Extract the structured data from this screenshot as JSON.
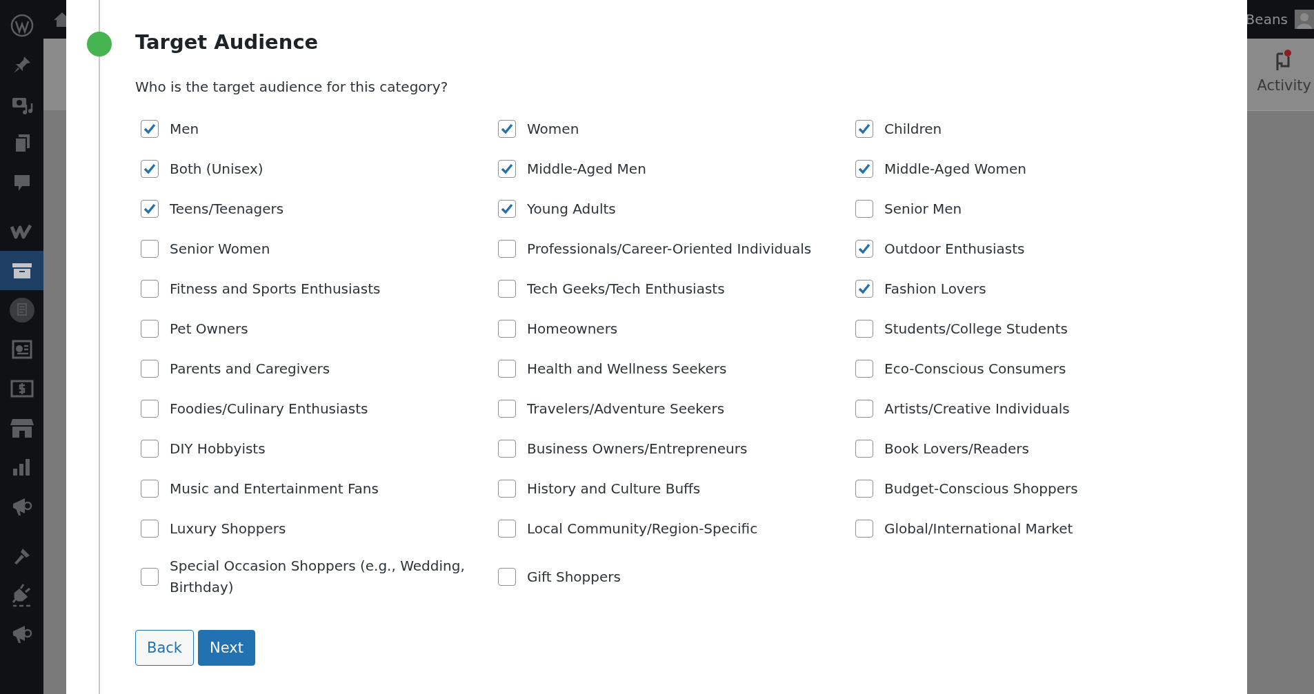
{
  "admin_bar": {
    "user_name": "Beans"
  },
  "activity_panel": {
    "label": "Activity"
  },
  "step": {
    "title": "Target Audience",
    "question": "Who is the target audience for this category?"
  },
  "options": [
    {
      "label": "Men",
      "checked": true
    },
    {
      "label": "Women",
      "checked": true
    },
    {
      "label": "Children",
      "checked": true
    },
    {
      "label": "Both (Unisex)",
      "checked": true
    },
    {
      "label": "Middle-Aged Men",
      "checked": true
    },
    {
      "label": "Middle-Aged Women",
      "checked": true
    },
    {
      "label": "Teens/Teenagers",
      "checked": true
    },
    {
      "label": "Young Adults",
      "checked": true
    },
    {
      "label": "Senior Men",
      "checked": false
    },
    {
      "label": "Senior Women",
      "checked": false
    },
    {
      "label": "Professionals/Career-Oriented Individuals",
      "checked": false
    },
    {
      "label": "Outdoor Enthusiasts",
      "checked": true
    },
    {
      "label": "Fitness and Sports Enthusiasts",
      "checked": false
    },
    {
      "label": "Tech Geeks/Tech Enthusiasts",
      "checked": false
    },
    {
      "label": "Fashion Lovers",
      "checked": true
    },
    {
      "label": "Pet Owners",
      "checked": false
    },
    {
      "label": "Homeowners",
      "checked": false
    },
    {
      "label": "Students/College Students",
      "checked": false
    },
    {
      "label": "Parents and Caregivers",
      "checked": false
    },
    {
      "label": "Health and Wellness Seekers",
      "checked": false
    },
    {
      "label": "Eco-Conscious Consumers",
      "checked": false
    },
    {
      "label": "Foodies/Culinary Enthusiasts",
      "checked": false
    },
    {
      "label": "Travelers/Adventure Seekers",
      "checked": false
    },
    {
      "label": "Artists/Creative Individuals",
      "checked": false
    },
    {
      "label": "DIY Hobbyists",
      "checked": false
    },
    {
      "label": "Business Owners/Entrepreneurs",
      "checked": false
    },
    {
      "label": "Book Lovers/Readers",
      "checked": false
    },
    {
      "label": "Music and Entertainment Fans",
      "checked": false
    },
    {
      "label": "History and Culture Buffs",
      "checked": false
    },
    {
      "label": "Budget-Conscious Shoppers",
      "checked": false
    },
    {
      "label": "Luxury Shoppers",
      "checked": false
    },
    {
      "label": "Local Community/Region-Specific",
      "checked": false
    },
    {
      "label": "Global/International Market",
      "checked": false
    },
    {
      "label": "Special Occasion Shoppers (e.g., Wedding, Birthday)",
      "checked": false
    },
    {
      "label": "Gift Shoppers",
      "checked": false
    }
  ],
  "buttons": [
    {
      "label": "Back",
      "kind": "secondary"
    },
    {
      "label": "Next",
      "kind": "primary"
    }
  ]
}
